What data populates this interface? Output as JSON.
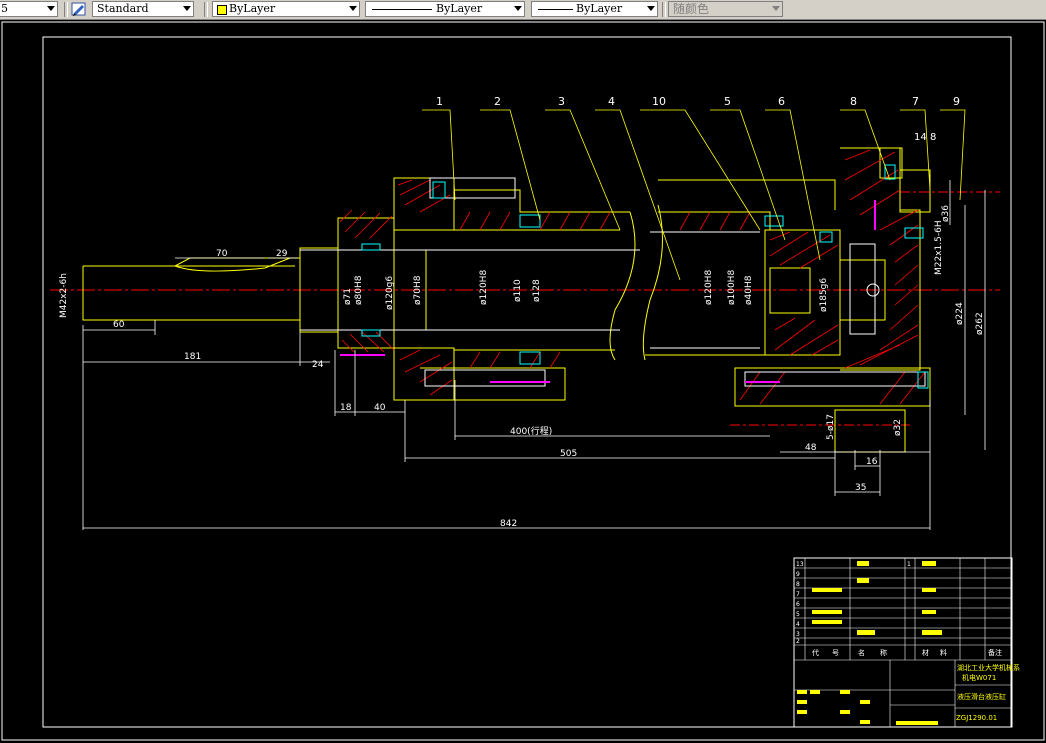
{
  "toolbar": {
    "layer_value": "5",
    "textstyle_value": "Standard",
    "color_value": "ByLayer",
    "linetype_value": "ByLayer",
    "lineweight_value": "ByLayer",
    "plotstyle_value": "随颜色"
  },
  "labels": {
    "leaders": [
      "1",
      "2",
      "3",
      "4",
      "10",
      "5",
      "6",
      "8",
      "7",
      "9"
    ],
    "leader_14": "14",
    "leader_8": "8"
  },
  "dims": {
    "d70": "70",
    "d29": "29",
    "d60": "60",
    "d181": "181",
    "d24": "24",
    "d18": "18",
    "d40": "40",
    "d400": "400(行程)",
    "d505": "505",
    "d48": "48",
    "d16": "16",
    "d35": "35",
    "d842": "842",
    "m42": "M42x2-6h",
    "phi71": "ø71",
    "phi80": "ø80H8",
    "phi120": "ø120g6",
    "phi70": "ø70H8",
    "phi120b": "ø120H8",
    "phi110": "ø110",
    "phi128": "ø128",
    "phi120c": "ø120H8",
    "phi100": "ø100H8",
    "phi40": "ø40H8",
    "phi185": "ø185g6",
    "phi36": "ø36",
    "m22": "M22x1.5-6H",
    "phi224": "ø224",
    "phi262": "ø262",
    "phi17": "5-ø17",
    "phi32": "ø32"
  },
  "title_block": {
    "headers": [
      "代",
      "号",
      "名",
      "称",
      "材",
      "料",
      "备注"
    ],
    "rows": [
      "13",
      "9",
      "8",
      "7",
      "6",
      "5",
      "4",
      "3",
      "2",
      "1"
    ],
    "company": "湖北工业大学机械系",
    "class": "机电W071",
    "part_name": "液压滑台液压缸",
    "drawing_no": "ZGJ1290.01"
  },
  "colors": {
    "bg": "#000000",
    "outline": "#ffffff",
    "part": "#ffff00",
    "hatch": "#ff0000",
    "centerline": "#ff0000",
    "pin": "#00ffff",
    "hole": "#ff00ff"
  },
  "icons": {
    "textstyle": "text-style-icon"
  }
}
